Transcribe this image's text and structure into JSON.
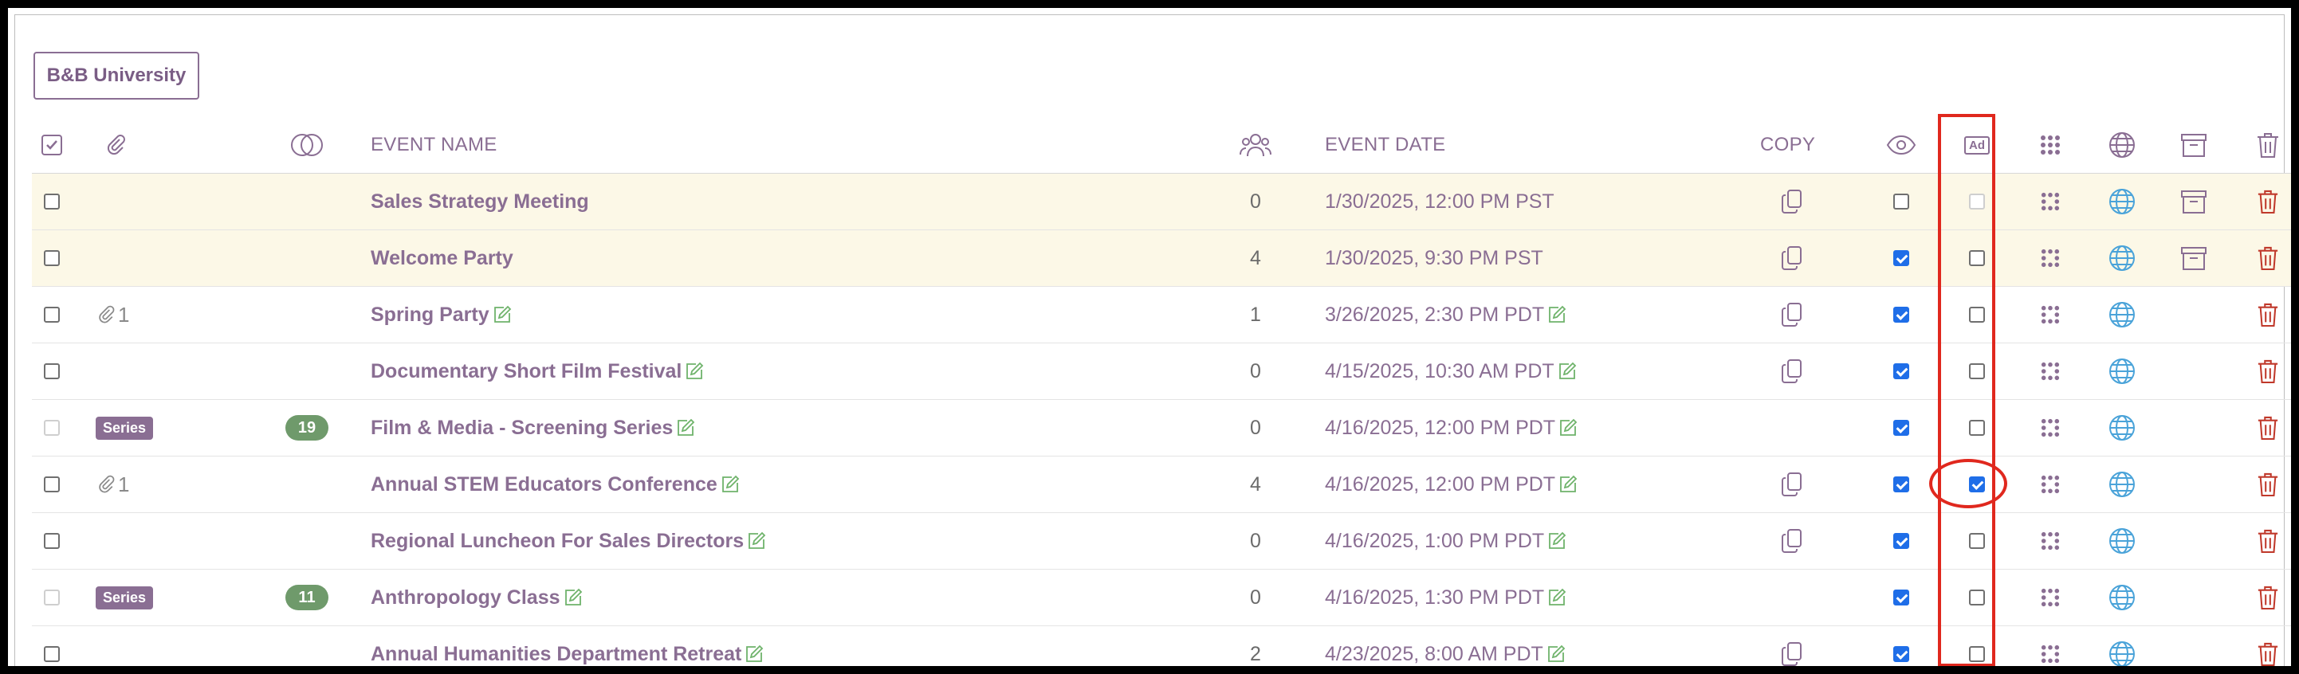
{
  "header_button": {
    "label": "B&B University"
  },
  "columns": {
    "select_all": "select-all-checkbox",
    "attachments": "paperclip-icon",
    "series": "overlap-circles-icon",
    "event_name": "EVENT NAME",
    "attendees": "people-icon",
    "event_date": "EVENT DATE",
    "copy": "COPY",
    "visible": "eye-icon",
    "ad": "Ad",
    "qr": "qr-dots-icon",
    "web": "globe-icon",
    "archive": "archive-box-icon",
    "delete": "trash-icon"
  },
  "colors": {
    "brand_purple": "#8a6e93",
    "highlight_row": "#fcf8e7",
    "delete_red": "#c0392b",
    "globe_blue": "#4aa3d9",
    "edit_green": "#6fb36b",
    "series_green": "#6f9a6b",
    "annotation_red": "#e0281e",
    "checkbox_blue": "#1f6ee8"
  },
  "rows": [
    {
      "name": "Sales Strategy Meeting",
      "count": "0",
      "date": "1/30/2025, 12:00 PM PST",
      "highlight": true,
      "select_disabled": false,
      "attach": "",
      "series": "",
      "series_count": "",
      "edit": false,
      "copy": true,
      "visible": false,
      "ad": false,
      "ad_disabled": true,
      "archive": true
    },
    {
      "name": "Welcome Party",
      "count": "4",
      "date": "1/30/2025, 9:30 PM PST",
      "highlight": true,
      "select_disabled": false,
      "attach": "",
      "series": "",
      "series_count": "",
      "edit": false,
      "copy": true,
      "visible": true,
      "ad": false,
      "ad_disabled": false,
      "archive": true
    },
    {
      "name": "Spring Party",
      "count": "1",
      "date": "3/26/2025, 2:30 PM PDT",
      "highlight": false,
      "select_disabled": false,
      "attach": "1",
      "series": "",
      "series_count": "",
      "edit": true,
      "copy": true,
      "visible": true,
      "ad": false,
      "ad_disabled": false,
      "archive": false
    },
    {
      "name": "Documentary Short Film Festival",
      "count": "0",
      "date": "4/15/2025, 10:30 AM PDT",
      "highlight": false,
      "select_disabled": false,
      "attach": "",
      "series": "",
      "series_count": "",
      "edit": true,
      "copy": true,
      "visible": true,
      "ad": false,
      "ad_disabled": false,
      "archive": false
    },
    {
      "name": "Film & Media - Screening Series",
      "count": "0",
      "date": "4/16/2025, 12:00 PM PDT",
      "highlight": false,
      "select_disabled": true,
      "attach": "",
      "series": "Series",
      "series_count": "19",
      "edit": true,
      "copy": false,
      "visible": true,
      "ad": false,
      "ad_disabled": false,
      "archive": false
    },
    {
      "name": "Annual STEM Educators Conference",
      "count": "4",
      "date": "4/16/2025, 12:00 PM PDT",
      "highlight": false,
      "select_disabled": false,
      "attach": "1",
      "series": "",
      "series_count": "",
      "edit": true,
      "copy": true,
      "visible": true,
      "ad": true,
      "ad_disabled": false,
      "archive": false
    },
    {
      "name": "Regional Luncheon For Sales Directors",
      "count": "0",
      "date": "4/16/2025, 1:00 PM PDT",
      "highlight": false,
      "select_disabled": false,
      "attach": "",
      "series": "",
      "series_count": "",
      "edit": true,
      "copy": true,
      "visible": true,
      "ad": false,
      "ad_disabled": false,
      "archive": false
    },
    {
      "name": "Anthropology Class",
      "count": "0",
      "date": "4/16/2025, 1:30 PM PDT",
      "highlight": false,
      "select_disabled": true,
      "attach": "",
      "series": "Series",
      "series_count": "11",
      "edit": true,
      "copy": false,
      "visible": true,
      "ad": false,
      "ad_disabled": false,
      "archive": false
    },
    {
      "name": "Annual Humanities Department Retreat",
      "count": "2",
      "date": "4/23/2025, 8:00 AM PDT",
      "highlight": false,
      "select_disabled": false,
      "attach": "",
      "series": "",
      "series_count": "",
      "edit": true,
      "copy": true,
      "visible": true,
      "ad": false,
      "ad_disabled": false,
      "archive": false
    }
  ]
}
